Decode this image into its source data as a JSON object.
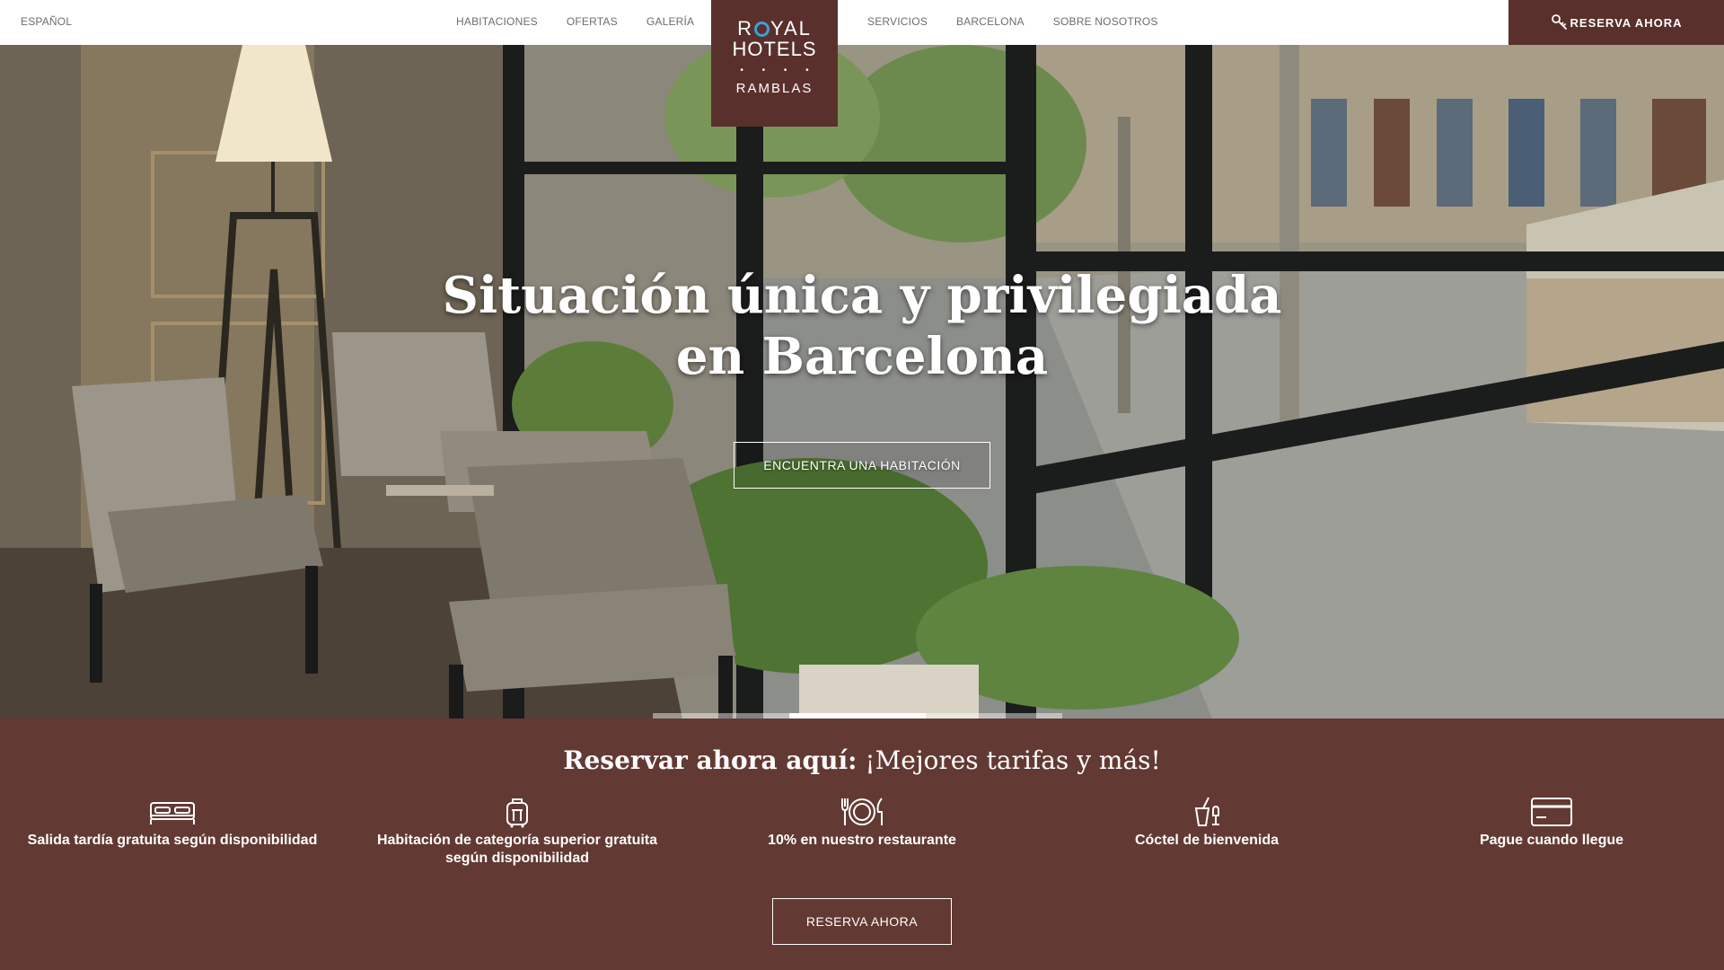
{
  "header": {
    "language": "ESPAÑOL",
    "nav_left": [
      "HABITACIONES",
      "OFERTAS",
      "GALERÍA"
    ],
    "nav_right": [
      "SERVICIOS",
      "BARCELONA",
      "SOBRE NOSOTROS"
    ],
    "book_button": "RESERVA AHORA",
    "book_icon": "key-icon"
  },
  "logo": {
    "line1_before": "R",
    "line1_after": "YAL",
    "line2": "HOTELS",
    "stars": "• • • •",
    "line3": "RAMBLAS",
    "accent_color": "#3aa0d6"
  },
  "hero": {
    "title": "Situación única y privilegiada en Barcelona",
    "cta": "ENCUENTRA UNA HABITACIÓN",
    "slides": 3,
    "active_slide": 2
  },
  "booking": {
    "title_bold": "Reservar ahora aquí:",
    "title_rest": " ¡Mejores tarifas y más!",
    "benefits": [
      {
        "icon": "bed-icon",
        "label": "Salida tardía gratuita según disponibilidad"
      },
      {
        "icon": "luggage-icon",
        "label": "Habitación de categoría superior gratuita según disponibilidad"
      },
      {
        "icon": "cutlery-icon",
        "label": "10% en nuestro restaurante"
      },
      {
        "icon": "cocktail-icon",
        "label": "Cóctel de bienvenida"
      },
      {
        "icon": "credit-card-icon",
        "label": "Pague cuando llegue"
      }
    ],
    "button": "RESERVA AHORA"
  },
  "colors": {
    "brand": "#5a302d",
    "strip": "#633933",
    "nav_text": "#6d6d6d"
  }
}
